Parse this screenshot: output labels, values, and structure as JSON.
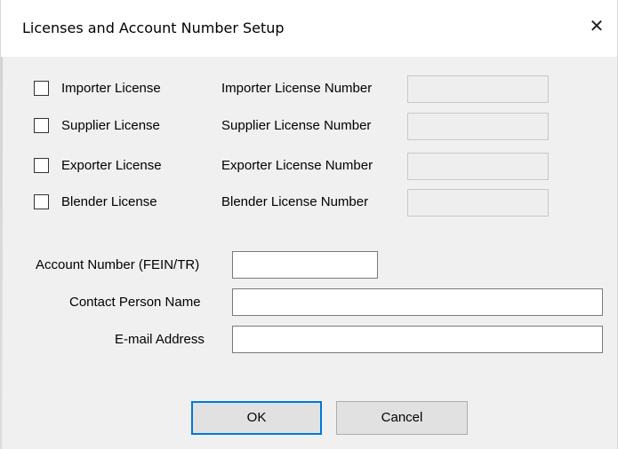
{
  "dialog": {
    "title": "Licenses and Account Number Setup",
    "close_symbol": "✕"
  },
  "licenses": [
    {
      "checkbox_label": "Importer License",
      "number_label": "Importer License Number",
      "checked": false,
      "number_value": ""
    },
    {
      "checkbox_label": "Supplier License",
      "number_label": "Supplier License Number",
      "checked": false,
      "number_value": ""
    },
    {
      "checkbox_label": "Exporter License",
      "number_label": "Exporter License Number",
      "checked": false,
      "number_value": ""
    },
    {
      "checkbox_label": "Blender License",
      "number_label": "Blender License Number",
      "checked": false,
      "number_value": ""
    }
  ],
  "account": {
    "account_number_label": "Account Number (FEIN/TR)",
    "account_number_value": "",
    "contact_label": "Contact Person Name",
    "contact_value": "",
    "email_label": "E-mail Address",
    "email_value": ""
  },
  "buttons": {
    "ok_label": "OK",
    "cancel_label": "Cancel"
  },
  "colors": {
    "dialog_bg": "#f0f0f0",
    "titlebar_bg": "#ffffff",
    "default_button_border": "#0078d7",
    "disabled_field_bg": "#eeeeee"
  }
}
